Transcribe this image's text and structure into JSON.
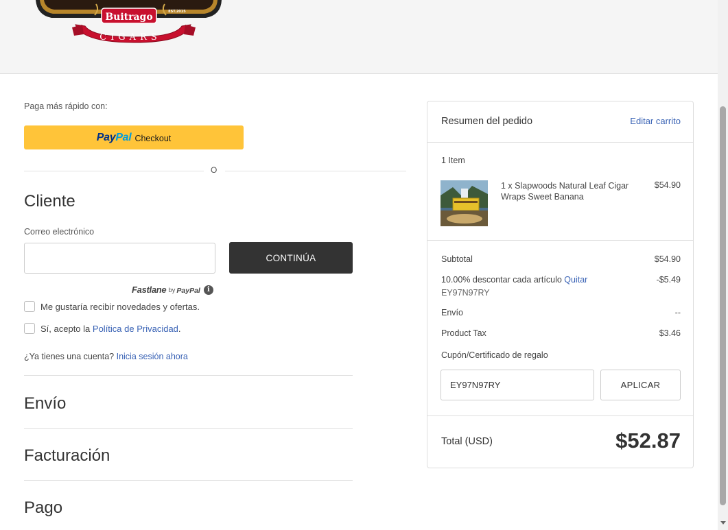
{
  "header": {
    "logo": {
      "brand": "Buitrago",
      "sub": "CIGARS",
      "est": "EST.2015"
    }
  },
  "express": {
    "label": "Paga más rápido con:",
    "paypal_pay": "Pay",
    "paypal_pal": "Pal",
    "paypal_checkout": "Checkout",
    "or_text": "O"
  },
  "customer": {
    "title": "Cliente",
    "email_label": "Correo electrónico",
    "email_value": "",
    "continue_label": "CONTINÚA",
    "fastlane_word": "Fastlane",
    "fastlane_by": "by",
    "fastlane_paypal": "PayPal",
    "fastlane_info_icon": "info-icon",
    "newsletter_label": "Me gustaría recibir novedades y ofertas.",
    "privacy_prefix": "Sí, acepto la",
    "privacy_link": "Política de Privacidad",
    "privacy_suffix": ".",
    "account_question": "¿Ya tienes una cuenta?",
    "signin_link": "Inicia sesión ahora"
  },
  "sections": {
    "shipping": "Envío",
    "billing": "Facturación",
    "payment": "Pago"
  },
  "summary": {
    "title": "Resumen del pedido",
    "edit_link": "Editar carrito",
    "items_count": "1 Item",
    "item": {
      "name": "1 x Slapwoods Natural Leaf Cigar Wraps Sweet Banana",
      "price": "$54.90"
    },
    "subtotal_label": "Subtotal",
    "subtotal_value": "$54.90",
    "discount_label": "10.00% descontar cada artículo",
    "discount_remove": "Quitar",
    "discount_code": "EY97N97RY",
    "discount_value": "-$5.49",
    "shipping_label": "Envío",
    "shipping_value": "--",
    "tax_label": "Product Tax",
    "tax_value": "$3.46",
    "coupon_label": "Cupón/Certificado de regalo",
    "coupon_value": "EY97N97RY",
    "apply_label": "APLICAR",
    "total_label": "Total (USD)",
    "total_value": "$52.87"
  },
  "colors": {
    "paypal_yellow": "#ffc439",
    "button_dark": "#333333",
    "link_blue": "#3a63b5"
  }
}
